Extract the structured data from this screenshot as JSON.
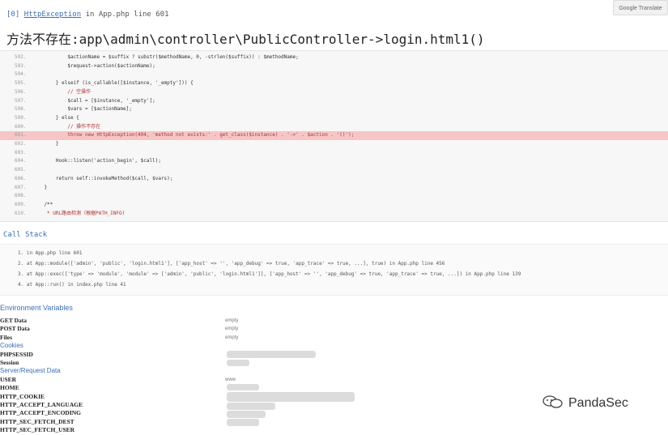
{
  "translate_button": "Google Translate",
  "exception": {
    "bracket": "[0]",
    "type": "HttpException",
    "location": "in App.php line 601",
    "message": "方法不存在:app\\admin\\controller\\PublicController->login.html1()"
  },
  "code": [
    {
      "ln": "592.",
      "text": "            $actionName = $suffix ? substr($methodName, 0, -strlen($suffix)) : $methodName;"
    },
    {
      "ln": "593.",
      "text": "            $request->action($actionName);"
    },
    {
      "ln": "594.",
      "text": ""
    },
    {
      "ln": "595.",
      "text": "        } elseif (is_callable([$instance, '_empty'])) {"
    },
    {
      "ln": "596.",
      "text": "            // 空操作",
      "comment": true
    },
    {
      "ln": "597.",
      "text": "            $call = [$instance, '_empty'];"
    },
    {
      "ln": "598.",
      "text": "            $vars = [$actionName];"
    },
    {
      "ln": "599.",
      "text": "        } else {"
    },
    {
      "ln": "600.",
      "text": "            // 操作不存在",
      "comment": true
    },
    {
      "ln": "601.",
      "text": "            throw new HttpException(404, 'method not exists:' . get_class($instance) . '->' . $action . '()');",
      "highlight": true
    },
    {
      "ln": "602.",
      "text": "        }"
    },
    {
      "ln": "603.",
      "text": ""
    },
    {
      "ln": "604.",
      "text": "        Hook::listen('action_begin', $call);"
    },
    {
      "ln": "605.",
      "text": ""
    },
    {
      "ln": "606.",
      "text": "        return self::invokeMethod($call, $vars);"
    },
    {
      "ln": "607.",
      "text": "    }"
    },
    {
      "ln": "608.",
      "text": ""
    },
    {
      "ln": "609.",
      "text": "    /**"
    },
    {
      "ln": "610.",
      "text": "     * URL路由检测（根据PATH_INFO)",
      "comment": true
    }
  ],
  "call_stack": {
    "title": "Call Stack",
    "items": [
      "1.  in App.php line 601",
      "2.  at App::module(['admin', 'public', 'login.html1'], ['app_host' => '', 'app_debug' => true, 'app_trace' => true, ...], true) in App.php line 456",
      "3.  at App::exec(['type' => 'module', 'module' => ['admin', 'public', 'login.html1']], ['app_host' => '', 'app_debug' => true, 'app_trace' => true, ...]) in App.php line 139",
      "4.  at App::run() in index.php line 41"
    ]
  },
  "environment": {
    "title": "Environment Variables",
    "rows": [
      {
        "key": "GET Data",
        "value": "empty"
      },
      {
        "key": "POST Data",
        "value": "empty"
      },
      {
        "key": "Files",
        "value": "empty"
      }
    ],
    "cookies_title": "Cookies",
    "cookies": [
      {
        "key": "PHPSESSID",
        "value": ""
      },
      {
        "key": "Session",
        "value": ""
      }
    ],
    "server_title": "Server/Request Data",
    "server": [
      {
        "key": "USER",
        "value": "www"
      },
      {
        "key": "HOME",
        "value": ""
      },
      {
        "key": "HTTP_COOKIE",
        "value": ""
      },
      {
        "key": "HTTP_ACCEPT_LANGUAGE",
        "value": ""
      },
      {
        "key": "HTTP_ACCEPT_ENCODING",
        "value": ""
      },
      {
        "key": "HTTP_SEC_FETCH_DEST",
        "value": ""
      },
      {
        "key": "HTTP_SEC_FETCH_USER",
        "value": ""
      }
    ]
  },
  "watermark": "PandaSec"
}
